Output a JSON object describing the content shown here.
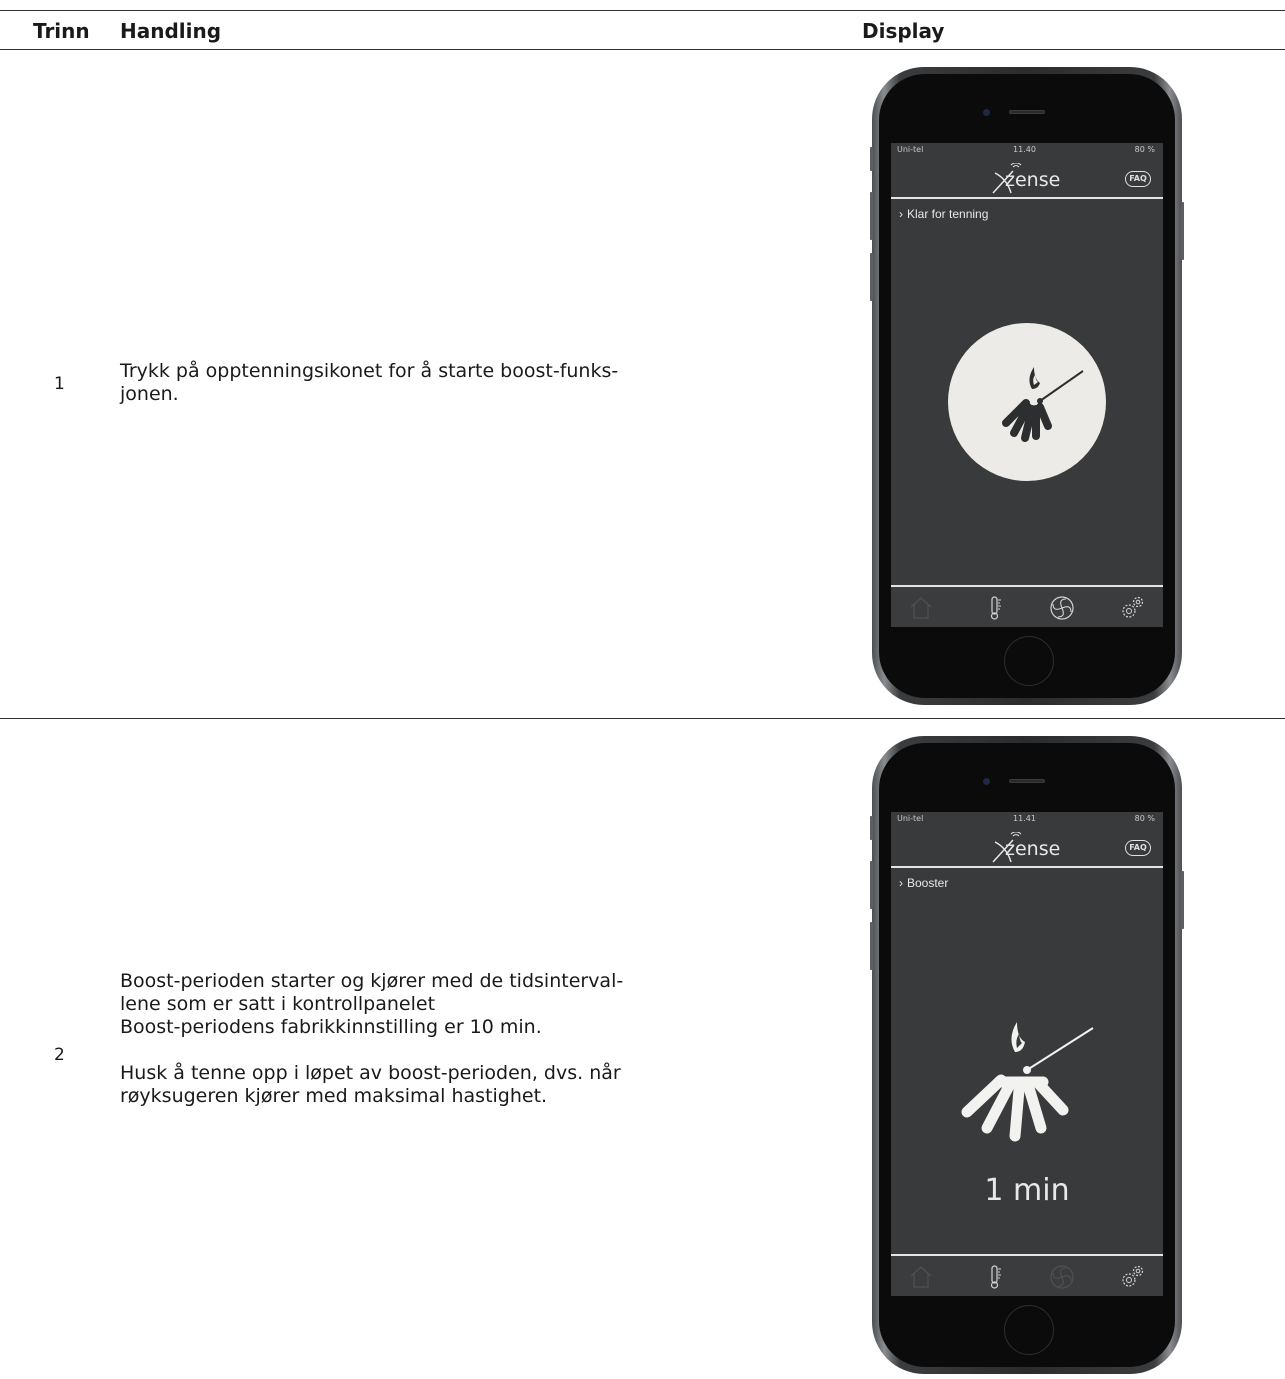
{
  "table": {
    "headers": {
      "trinn": "Trinn",
      "handling": "Handling",
      "display": "Display"
    },
    "rows": [
      {
        "step": "1",
        "text": "Trykk på opptenningsikonet for å starte boost-funks-\njonen.",
        "phone": {
          "carrier": "Uni-tel",
          "time": "11.40",
          "battery": "80 %",
          "logo": "zense",
          "faq": "FAQ",
          "crumb": "Klar for tenning"
        }
      },
      {
        "step": "2",
        "text_a": "Boost-perioden starter og kjører med de tidsinterval-\nlene som er satt i kontrollpanelet\nBoost-periodens fabrikkinnstilling er 10 min.",
        "text_b": "Husk å tenne opp i løpet av boost-perioden, dvs. når\nrøyksugeren kjører med maksimal hastighet.",
        "phone": {
          "carrier": "Uni-tel",
          "time": "11.41",
          "battery": "80 %",
          "logo": "zense",
          "faq": "FAQ",
          "crumb": "Booster",
          "timer": "1 min"
        }
      }
    ]
  },
  "icons": [
    "home-icon",
    "thermometer-icon",
    "fan-icon",
    "settings-gears-icon",
    "fire-ignition-icon",
    "chevron-right-icon"
  ],
  "colors": {
    "screen_bg": "#383a3b",
    "circle_bg": "#ecebe8",
    "rule": "#333333"
  }
}
